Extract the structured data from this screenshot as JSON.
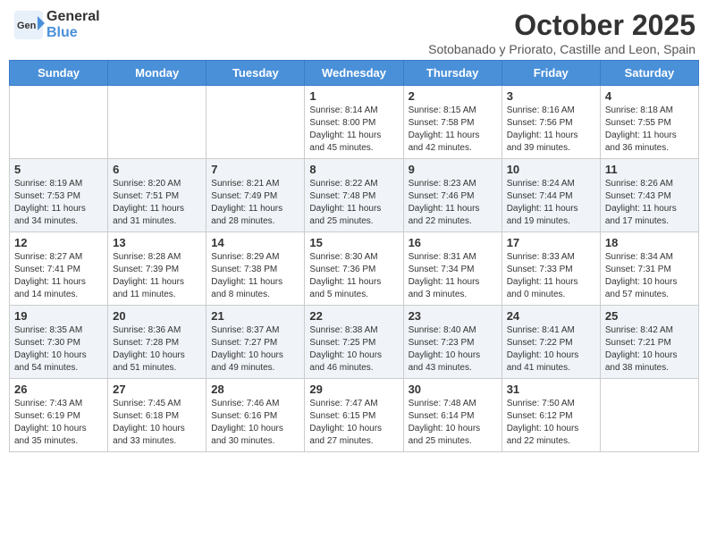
{
  "logo": {
    "general": "General",
    "blue": "Blue"
  },
  "title": "October 2025",
  "subtitle": "Sotobanado y Priorato, Castille and Leon, Spain",
  "days_of_week": [
    "Sunday",
    "Monday",
    "Tuesday",
    "Wednesday",
    "Thursday",
    "Friday",
    "Saturday"
  ],
  "weeks": [
    [
      {
        "day": "",
        "content": ""
      },
      {
        "day": "",
        "content": ""
      },
      {
        "day": "",
        "content": ""
      },
      {
        "day": "1",
        "content": "Sunrise: 8:14 AM\nSunset: 8:00 PM\nDaylight: 11 hours and 45 minutes."
      },
      {
        "day": "2",
        "content": "Sunrise: 8:15 AM\nSunset: 7:58 PM\nDaylight: 11 hours and 42 minutes."
      },
      {
        "day": "3",
        "content": "Sunrise: 8:16 AM\nSunset: 7:56 PM\nDaylight: 11 hours and 39 minutes."
      },
      {
        "day": "4",
        "content": "Sunrise: 8:18 AM\nSunset: 7:55 PM\nDaylight: 11 hours and 36 minutes."
      }
    ],
    [
      {
        "day": "5",
        "content": "Sunrise: 8:19 AM\nSunset: 7:53 PM\nDaylight: 11 hours and 34 minutes."
      },
      {
        "day": "6",
        "content": "Sunrise: 8:20 AM\nSunset: 7:51 PM\nDaylight: 11 hours and 31 minutes."
      },
      {
        "day": "7",
        "content": "Sunrise: 8:21 AM\nSunset: 7:49 PM\nDaylight: 11 hours and 28 minutes."
      },
      {
        "day": "8",
        "content": "Sunrise: 8:22 AM\nSunset: 7:48 PM\nDaylight: 11 hours and 25 minutes."
      },
      {
        "day": "9",
        "content": "Sunrise: 8:23 AM\nSunset: 7:46 PM\nDaylight: 11 hours and 22 minutes."
      },
      {
        "day": "10",
        "content": "Sunrise: 8:24 AM\nSunset: 7:44 PM\nDaylight: 11 hours and 19 minutes."
      },
      {
        "day": "11",
        "content": "Sunrise: 8:26 AM\nSunset: 7:43 PM\nDaylight: 11 hours and 17 minutes."
      }
    ],
    [
      {
        "day": "12",
        "content": "Sunrise: 8:27 AM\nSunset: 7:41 PM\nDaylight: 11 hours and 14 minutes."
      },
      {
        "day": "13",
        "content": "Sunrise: 8:28 AM\nSunset: 7:39 PM\nDaylight: 11 hours and 11 minutes."
      },
      {
        "day": "14",
        "content": "Sunrise: 8:29 AM\nSunset: 7:38 PM\nDaylight: 11 hours and 8 minutes."
      },
      {
        "day": "15",
        "content": "Sunrise: 8:30 AM\nSunset: 7:36 PM\nDaylight: 11 hours and 5 minutes."
      },
      {
        "day": "16",
        "content": "Sunrise: 8:31 AM\nSunset: 7:34 PM\nDaylight: 11 hours and 3 minutes."
      },
      {
        "day": "17",
        "content": "Sunrise: 8:33 AM\nSunset: 7:33 PM\nDaylight: 11 hours and 0 minutes."
      },
      {
        "day": "18",
        "content": "Sunrise: 8:34 AM\nSunset: 7:31 PM\nDaylight: 10 hours and 57 minutes."
      }
    ],
    [
      {
        "day": "19",
        "content": "Sunrise: 8:35 AM\nSunset: 7:30 PM\nDaylight: 10 hours and 54 minutes."
      },
      {
        "day": "20",
        "content": "Sunrise: 8:36 AM\nSunset: 7:28 PM\nDaylight: 10 hours and 51 minutes."
      },
      {
        "day": "21",
        "content": "Sunrise: 8:37 AM\nSunset: 7:27 PM\nDaylight: 10 hours and 49 minutes."
      },
      {
        "day": "22",
        "content": "Sunrise: 8:38 AM\nSunset: 7:25 PM\nDaylight: 10 hours and 46 minutes."
      },
      {
        "day": "23",
        "content": "Sunrise: 8:40 AM\nSunset: 7:23 PM\nDaylight: 10 hours and 43 minutes."
      },
      {
        "day": "24",
        "content": "Sunrise: 8:41 AM\nSunset: 7:22 PM\nDaylight: 10 hours and 41 minutes."
      },
      {
        "day": "25",
        "content": "Sunrise: 8:42 AM\nSunset: 7:21 PM\nDaylight: 10 hours and 38 minutes."
      }
    ],
    [
      {
        "day": "26",
        "content": "Sunrise: 7:43 AM\nSunset: 6:19 PM\nDaylight: 10 hours and 35 minutes."
      },
      {
        "day": "27",
        "content": "Sunrise: 7:45 AM\nSunset: 6:18 PM\nDaylight: 10 hours and 33 minutes."
      },
      {
        "day": "28",
        "content": "Sunrise: 7:46 AM\nSunset: 6:16 PM\nDaylight: 10 hours and 30 minutes."
      },
      {
        "day": "29",
        "content": "Sunrise: 7:47 AM\nSunset: 6:15 PM\nDaylight: 10 hours and 27 minutes."
      },
      {
        "day": "30",
        "content": "Sunrise: 7:48 AM\nSunset: 6:14 PM\nDaylight: 10 hours and 25 minutes."
      },
      {
        "day": "31",
        "content": "Sunrise: 7:50 AM\nSunset: 6:12 PM\nDaylight: 10 hours and 22 minutes."
      },
      {
        "day": "",
        "content": ""
      }
    ]
  ]
}
